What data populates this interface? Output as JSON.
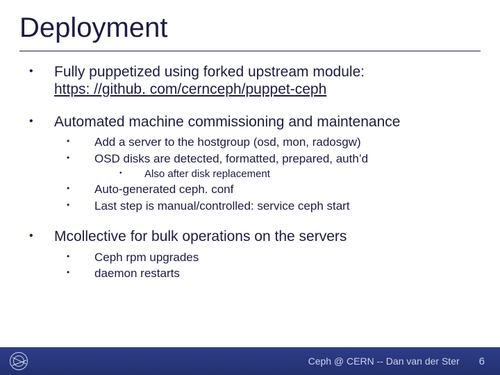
{
  "title": "Deployment",
  "bullets": {
    "b1_line1": "Fully puppetized using forked upstream module:",
    "b1_link": "https: //github. com/cernceph/puppet-ceph",
    "b2": "Automated machine commissioning and maintenance",
    "b2_sub": {
      "s1": "Add a server to the hostgroup (osd, mon, radosgw)",
      "s2": "OSD disks are detected, formatted, prepared, auth’d",
      "s2_sub1": "Also after disk replacement",
      "s3": "Auto-generated ceph. conf",
      "s4": "Last step is manual/controlled: service ceph start"
    },
    "b3": "Mcollective for bulk operations on the servers",
    "b3_sub": {
      "s1": "Ceph rpm upgrades",
      "s2": "daemon restarts"
    }
  },
  "footer": {
    "text": "Ceph @ CERN -- Dan van der Ster",
    "page": "6"
  }
}
